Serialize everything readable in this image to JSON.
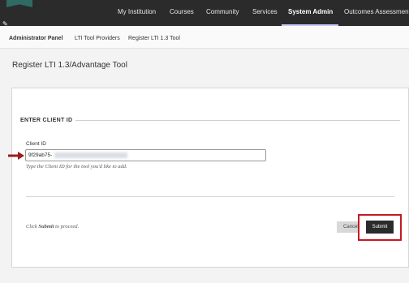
{
  "nav": {
    "items": [
      {
        "label": "My Institution"
      },
      {
        "label": "Courses"
      },
      {
        "label": "Community"
      },
      {
        "label": "Services"
      },
      {
        "label": "System Admin",
        "active": true
      },
      {
        "label": "Outcomes Assessment"
      }
    ],
    "pin_icon": "pin-icon"
  },
  "breadcrumb": {
    "items": [
      {
        "label": "Administrator Panel"
      },
      {
        "label": "LTI Tool Providers"
      },
      {
        "label": "Register LTI 1.3 Tool"
      }
    ]
  },
  "page": {
    "title": "Register LTI 1.3/Advantage Tool"
  },
  "form": {
    "section_title": "ENTER CLIENT ID",
    "client_id_label": "Client ID",
    "client_id_value": "9f29ab75-",
    "client_id_help": "Type the Client ID for the tool you'd like to add.",
    "proceed_prefix": "Click ",
    "proceed_bold": "Submit",
    "proceed_suffix": " to proceed.",
    "cancel_label": "Cancel",
    "submit_label": "Submit"
  },
  "colors": {
    "nav_bg": "#2b2b2b",
    "highlight": "#c41a22",
    "arrow": "#9b1c1c"
  }
}
